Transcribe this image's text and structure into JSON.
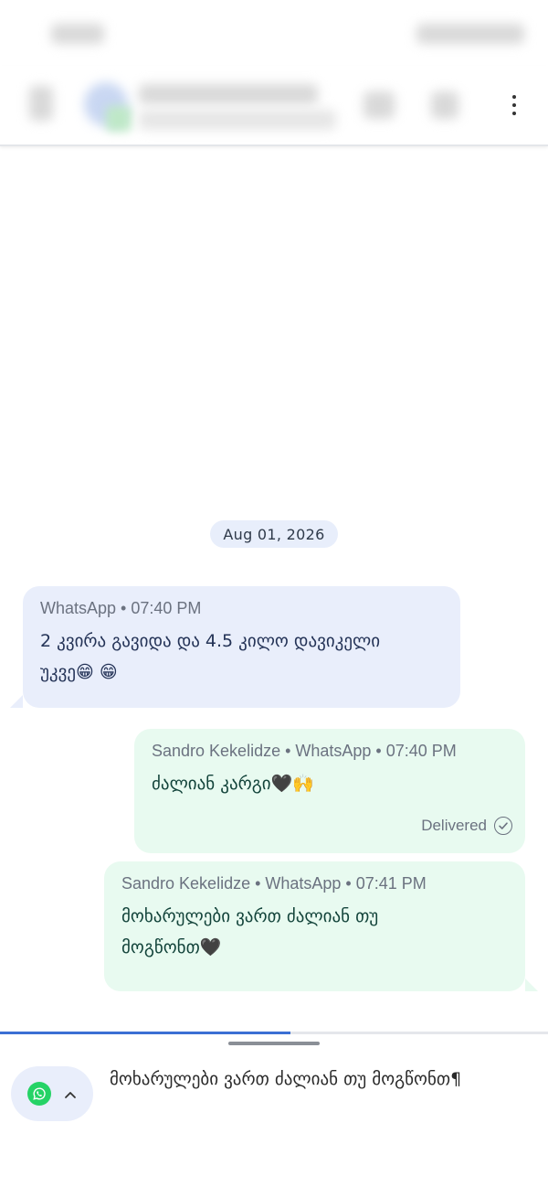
{
  "header": {
    "more_icon": "more-vertical-icon"
  },
  "conversation": {
    "date_chip": "Aug 01, 2026",
    "messages": [
      {
        "direction": "incoming",
        "meta": "WhatsApp • 07:40 PM",
        "text_line1": "2 კვირა გავიდა და 4.5 კილო დავიკელი",
        "text_line2": "უკვე😁 😁"
      },
      {
        "direction": "outgoing",
        "meta": "Sandro Kekelidze • WhatsApp • 07:40 PM",
        "text_line1": "ძალიან კარგი🖤🙌",
        "status": "Delivered"
      },
      {
        "direction": "outgoing",
        "meta": "Sandro Kekelidze • WhatsApp • 07:41 PM",
        "text_line1": "მოხარულები ვართ ძალიან თუ",
        "text_line2": "მოგწონთ🖤"
      }
    ]
  },
  "composer": {
    "progress_fraction": 0.53,
    "channel_icon": "whatsapp-icon",
    "channel_chevron": "chevron-up-icon",
    "draft_text": "მოხარულები ვართ ძალიან თუ მოგწონთ",
    "pilcrow": "¶"
  },
  "colors": {
    "incoming_bubble": "#e9eefb",
    "outgoing_bubble": "#e8faf0",
    "accent_blue": "#3b6fd4",
    "whatsapp_green": "#25d366"
  }
}
